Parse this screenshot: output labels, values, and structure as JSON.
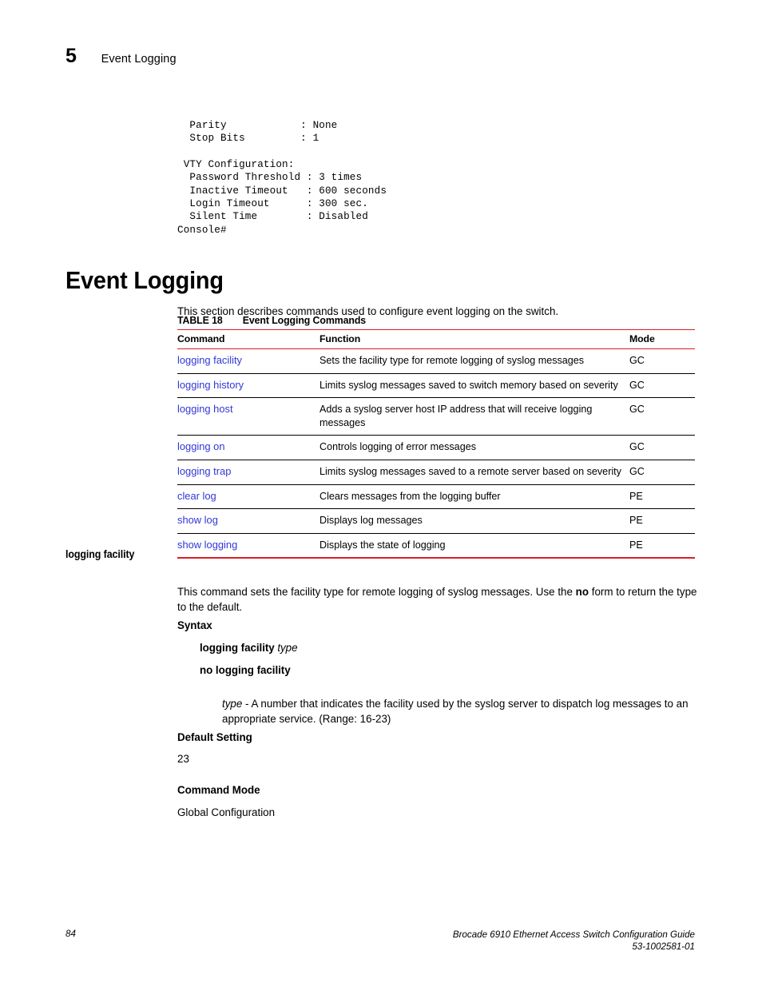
{
  "header": {
    "chapter_number": "5",
    "chapter_title": "Event Logging"
  },
  "console_output": "  Parity            : None\n  Stop Bits         : 1\n\n VTY Configuration:\n  Password Threshold : 3 times\n  Inactive Timeout   : 600 seconds\n  Login Timeout      : 300 sec.\n  Silent Time        : Disabled\nConsole#",
  "section": {
    "heading": "Event Logging",
    "intro": "This section describes commands used to configure event logging on the switch."
  },
  "table": {
    "caption_number": "TABLE 18",
    "caption_title": "Event Logging Commands",
    "columns": [
      "Command",
      "Function",
      "Mode"
    ],
    "rows": [
      {
        "command": "logging facility",
        "function": "Sets the facility type for remote logging of syslog messages",
        "mode": "GC"
      },
      {
        "command": "logging history",
        "function": "Limits syslog messages saved to switch memory based on severity",
        "mode": "GC"
      },
      {
        "command": "logging host",
        "function": "Adds a syslog server host IP address that will receive logging messages",
        "mode": "GC"
      },
      {
        "command": "logging on",
        "function": "Controls logging of error messages",
        "mode": "GC"
      },
      {
        "command": "logging trap",
        "function": "Limits syslog messages saved to a remote server based on severity",
        "mode": "GC"
      },
      {
        "command": "clear log",
        "function": "Clears messages from the logging buffer",
        "mode": "PE"
      },
      {
        "command": "show log",
        "function": "Displays log messages",
        "mode": "PE"
      },
      {
        "command": "show logging",
        "function": "Displays the state of logging",
        "mode": "PE"
      }
    ]
  },
  "command_entry": {
    "side_head": "logging facility",
    "description_before_bold": "This command sets the facility type for remote logging of syslog messages. Use the ",
    "description_bold": "no",
    "description_after_bold": " form to return the type to the default.",
    "syntax_heading": "Syntax",
    "syntax_form_1_command": "logging facility",
    "syntax_form_1_arg": "type",
    "syntax_form_2": "no logging facility",
    "arg_name": "type",
    "arg_description": " - A number that indicates the facility used by the syslog server to dispatch log messages to an appropriate service. (Range: 16-23)",
    "default_setting_heading": "Default Setting",
    "default_setting_value": "23",
    "command_mode_heading": "Command Mode",
    "command_mode_value": "Global Configuration"
  },
  "footer": {
    "page_number": "84",
    "doc_title": "Brocade 6910 Ethernet Access Switch Configuration Guide",
    "doc_number": "53-1002581-01"
  },
  "colors": {
    "rule_red": "#d81e26",
    "link_blue": "#3138d6"
  }
}
